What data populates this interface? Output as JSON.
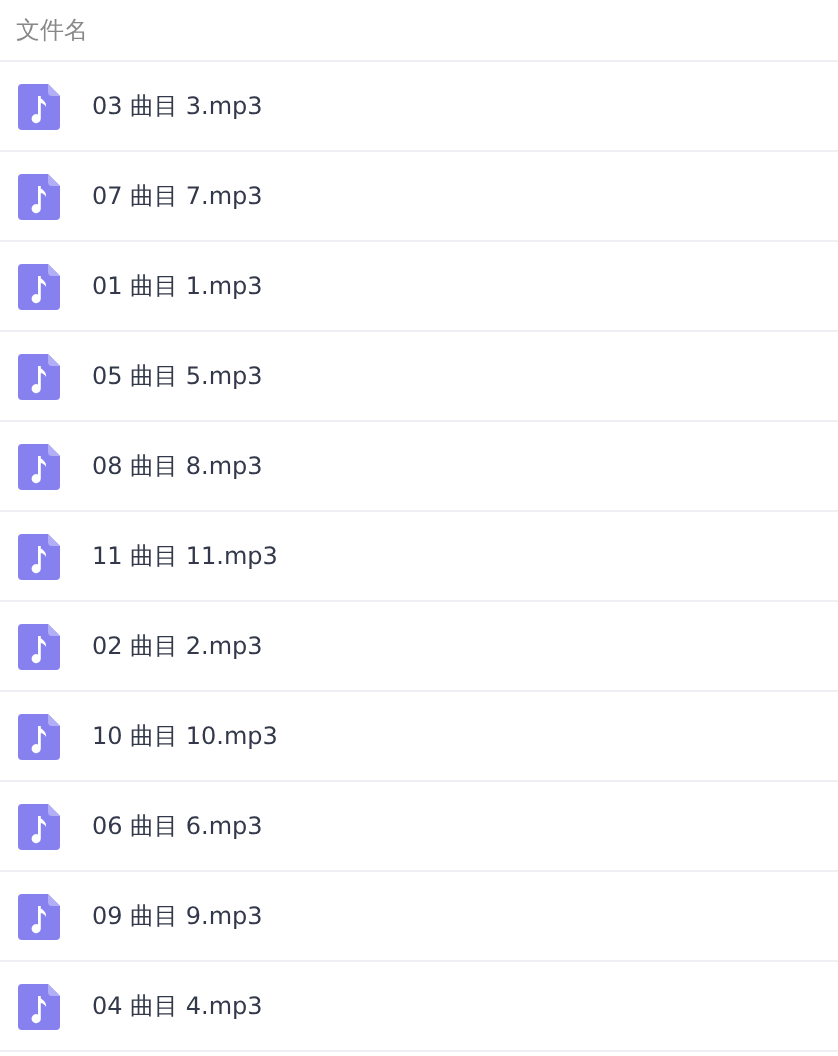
{
  "table": {
    "columns": [
      "文件名"
    ],
    "rows": [
      {
        "name": "03 曲目 3.mp3"
      },
      {
        "name": "07 曲目 7.mp3"
      },
      {
        "name": "01 曲目 1.mp3"
      },
      {
        "name": "05 曲目 5.mp3"
      },
      {
        "name": "08 曲目 8.mp3"
      },
      {
        "name": "11 曲目 11.mp3"
      },
      {
        "name": "02 曲目 2.mp3"
      },
      {
        "name": "10 曲目 10.mp3"
      },
      {
        "name": "06 曲目 6.mp3"
      },
      {
        "name": "09 曲目 9.mp3"
      },
      {
        "name": "04 曲目 4.mp3"
      }
    ]
  }
}
